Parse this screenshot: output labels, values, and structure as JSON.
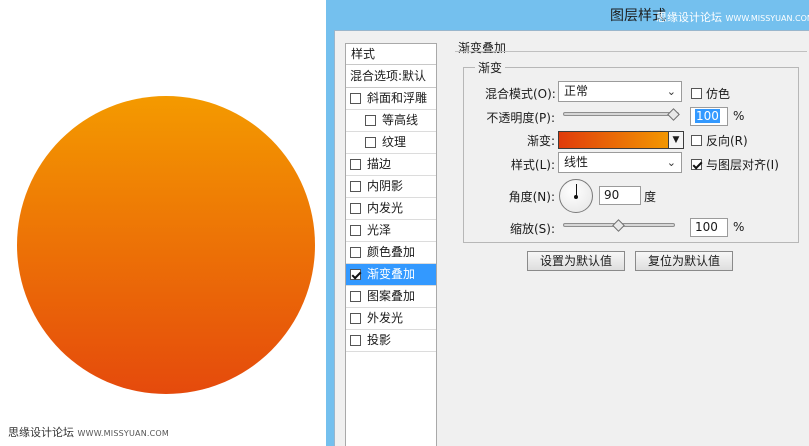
{
  "watermark": {
    "label": "思缘设计论坛",
    "site": "WWW.MISSYUAN.COM"
  },
  "canvas": {
    "circle_gradient_top": "#f49a00",
    "circle_gradient_bottom": "#e54a0c"
  },
  "dialog": {
    "title": "图层样式"
  },
  "style_list": {
    "header": "样式",
    "blend_options": "混合选项:默认",
    "items": [
      {
        "label": "斜面和浮雕",
        "checked": false,
        "sub": false,
        "selected": false
      },
      {
        "label": "等高线",
        "checked": false,
        "sub": true,
        "selected": false
      },
      {
        "label": "纹理",
        "checked": false,
        "sub": true,
        "selected": false
      },
      {
        "label": "描边",
        "checked": false,
        "sub": false,
        "selected": false
      },
      {
        "label": "内阴影",
        "checked": false,
        "sub": false,
        "selected": false
      },
      {
        "label": "内发光",
        "checked": false,
        "sub": false,
        "selected": false
      },
      {
        "label": "光泽",
        "checked": false,
        "sub": false,
        "selected": false
      },
      {
        "label": "颜色叠加",
        "checked": false,
        "sub": false,
        "selected": false
      },
      {
        "label": "渐变叠加",
        "checked": true,
        "sub": false,
        "selected": true
      },
      {
        "label": "图案叠加",
        "checked": false,
        "sub": false,
        "selected": false
      },
      {
        "label": "外发光",
        "checked": false,
        "sub": false,
        "selected": false
      },
      {
        "label": "投影",
        "checked": false,
        "sub": false,
        "selected": false
      }
    ]
  },
  "panel": {
    "group_title": "渐变叠加",
    "subgroup_title": "渐变",
    "blend_mode_label": "混合模式(O):",
    "blend_mode_value": "正常",
    "dither_label": "仿色",
    "opacity_label": "不透明度(P):",
    "opacity_value": "100",
    "opacity_unit": "%",
    "opacity_level": 100,
    "gradient_label": "渐变:",
    "gradient_colors": [
      "#e03c0c",
      "#f5a000"
    ],
    "reverse_label": "反向(R)",
    "style_label": "样式(L):",
    "style_value": "线性",
    "align_label": "与图层对齐(I)",
    "align_checked": true,
    "angle_label": "角度(N):",
    "angle_value": "90",
    "angle_unit": "度",
    "scale_label": "缩放(S):",
    "scale_value": "100",
    "scale_unit": "%",
    "scale_level": 100,
    "btn_set_default": "设置为默认值",
    "btn_reset_default": "复位为默认值"
  }
}
